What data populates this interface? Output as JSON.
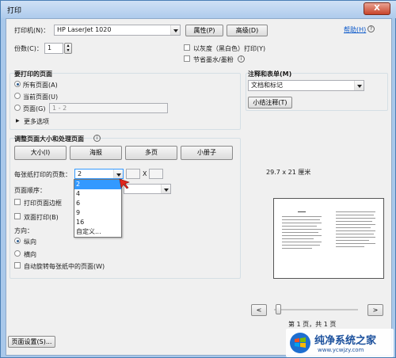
{
  "window": {
    "title": "打印",
    "close": "X"
  },
  "printer": {
    "label": "打印机(N)：",
    "value": "HP LaserJet 1020",
    "properties_btn": "属性(P)",
    "advanced_btn": "高级(D)",
    "help_link": "帮助(H)"
  },
  "copies": {
    "label": "份数(C)：",
    "value": "1"
  },
  "options": {
    "grayscale": "以灰度（黑白色）打印(Y)",
    "save_ink": "节省墨水/墨粉"
  },
  "pages_group": {
    "title": "要打印的页面",
    "all": "所有页面(A)",
    "current": "当前页面(U)",
    "pages": "页面(G)",
    "pages_placeholder": "1 - 2",
    "more": "更多选项"
  },
  "comments_group": {
    "title": "注释和表单(M)",
    "value": "文档和标记",
    "summarize_btn": "小结注释(T)"
  },
  "sizing_group": {
    "title": "调整页面大小和处理页面",
    "tabs": [
      "大小(I)",
      "海报",
      "多页",
      "小册子"
    ],
    "per_sheet_label": "每张纸打印的页数：",
    "per_sheet_value": "2",
    "by_label": "X",
    "order_label": "页面顺序：",
    "border_label": "打印页面边框",
    "duplex_label": "双面打印(B)",
    "orientation_label": "方向：",
    "portrait": "纵向",
    "landscape": "横向",
    "autorotate": "自动旋转每张纸中的页面(W)",
    "dropdown_options": [
      "2",
      "4",
      "6",
      "9",
      "16",
      "自定义..."
    ]
  },
  "preview": {
    "size_label": "29.7 x 21 厘米",
    "prev_btn": "<",
    "next_btn": ">",
    "page_status": "第 1 页，共 1 页"
  },
  "footer": {
    "page_setup_btn": "页面设置(S)..."
  },
  "watermark": {
    "brand": "纯净系统之家",
    "url": "www.ycwjzy.com"
  },
  "colors": {
    "accent": "#3399ff",
    "titlebar": "#aecbec",
    "close": "#c8442a"
  }
}
